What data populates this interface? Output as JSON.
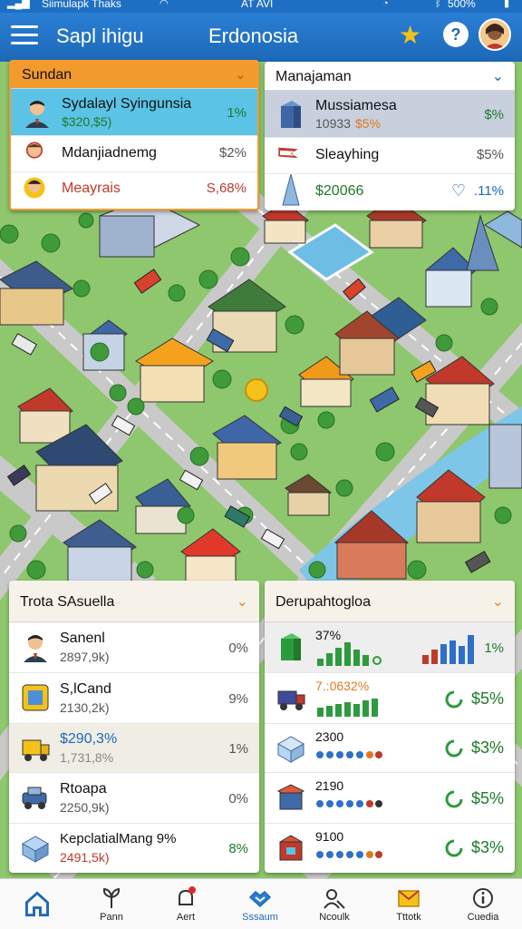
{
  "status": {
    "left": "Siimulapk Thaks",
    "center": "AT AVI",
    "right": "500%"
  },
  "header": {
    "title": "Sapl ihigu",
    "city": "Erdonosia"
  },
  "panel_top_left": {
    "title": "Sundan",
    "rows": [
      {
        "name": "Sydalayl Syingunsia",
        "sub": "$320,$5)",
        "pct": "1%"
      },
      {
        "name": "Mdanjiadnemg",
        "pct": "$2%"
      },
      {
        "name": "Meayrais",
        "pct": "S,68%"
      }
    ]
  },
  "panel_top_right": {
    "title": "Manajaman",
    "rows": [
      {
        "name": "Mussiamesa",
        "sub_a": "10933",
        "sub_b": "$5%",
        "pct": "$%"
      },
      {
        "name": "Sleayhing",
        "pct": "$5%"
      },
      {
        "name": "$20066",
        "pct": ".11%"
      }
    ]
  },
  "panel_bottom_left": {
    "title": "Trota SAsuella",
    "rows": [
      {
        "name": "Sanenl",
        "sub": "2897,9k)",
        "pct": "0%"
      },
      {
        "name": "S,lCand",
        "sub": "2130,2k)",
        "pct": "9%"
      },
      {
        "name": "$290,3%",
        "sub": "1,731,8%",
        "pct": "1%"
      },
      {
        "name": "Rtoapa",
        "sub": "2250,9k)",
        "pct": "0%"
      },
      {
        "name": "KepclatialMang 9%",
        "sub": "2491,5k)",
        "pct": "8%"
      }
    ]
  },
  "panel_bottom_right": {
    "title": "Derupahtogloa",
    "rows": [
      {
        "name": "37%",
        "pct": "1%"
      },
      {
        "name": "7.:0632%",
        "pct": "$5%"
      },
      {
        "name": "2300",
        "pct": "$3%"
      },
      {
        "name": "2190",
        "pct": "$5%"
      },
      {
        "name": "9100",
        "pct": "$3%"
      }
    ]
  },
  "nav": [
    {
      "label": "",
      "icon": "home-icon"
    },
    {
      "label": "Pann",
      "icon": "leaf-icon"
    },
    {
      "label": "Aert",
      "icon": "bell-icon"
    },
    {
      "label": "Sssaum",
      "icon": "handshake-icon"
    },
    {
      "label": "Ncoulk",
      "icon": "people-icon"
    },
    {
      "label": "Tttotk",
      "icon": "mail-icon"
    },
    {
      "label": "Cuedia",
      "icon": "info-icon"
    }
  ]
}
